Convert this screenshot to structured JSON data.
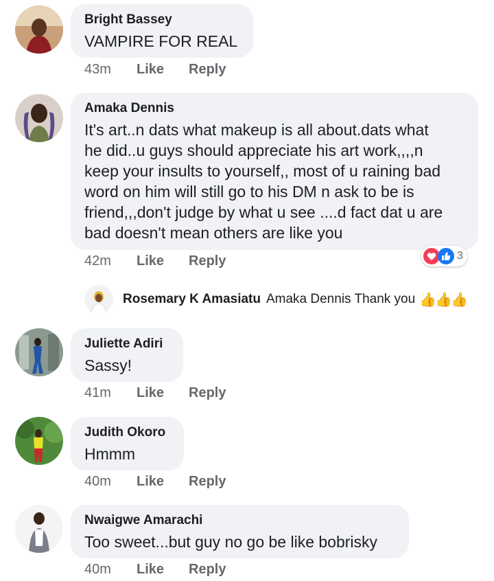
{
  "comments": [
    {
      "author": "Bright Bassey",
      "text": "VAMPIRE FOR  REAL",
      "time": "43m",
      "like": "Like",
      "reply": "Reply"
    },
    {
      "author": "Amaka Dennis",
      "text_lines": [
        "It's art..n dats what makeup is all about.dats what",
        "he did..u guys should appreciate his art work,,,,n",
        "keep your insults to  yourself,, most of u raining bad",
        "word on him will still go to his DM n ask to be is",
        "friend,,,don't judge by what u see ....d fact dat u are",
        "bad doesn't mean others are like you"
      ],
      "time": "42m",
      "like": "Like",
      "reply": "Reply",
      "reactions": {
        "count": "3",
        "types": [
          "love-icon",
          "like-icon"
        ]
      },
      "reply_preview": {
        "author": "Rosemary K Amasiatu",
        "text": "Amaka Dennis Thank you",
        "emoji": "👍👍👍"
      }
    },
    {
      "author": "Juliette Adiri",
      "text": "Sassy!",
      "time": "41m",
      "like": "Like",
      "reply": "Reply"
    },
    {
      "author": "Judith Okoro",
      "text": "Hmmm",
      "time": "40m",
      "like": "Like",
      "reply": "Reply"
    },
    {
      "author": "Nwaigwe Amarachi",
      "text": "Too sweet...but guy no go be like bobrisky",
      "time": "40m",
      "like": "Like",
      "reply": "Reply"
    }
  ],
  "colors": {
    "bubble": "#f0f2f5",
    "meta": "#65676b",
    "love": "#f33e58",
    "like": "#1877f2"
  }
}
